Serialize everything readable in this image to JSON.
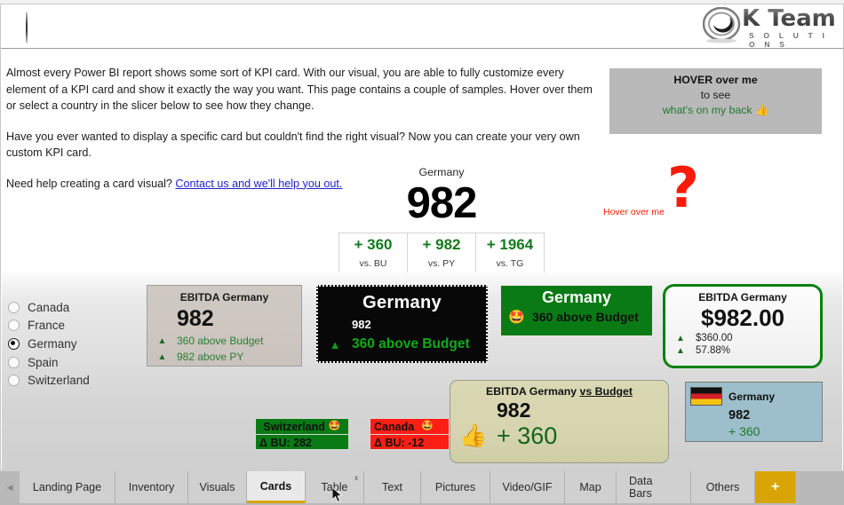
{
  "header": {
    "logo_text": "K Team",
    "logo_sub": "S O L U T I O N S",
    "logo_icon": "swirl-logo-icon"
  },
  "intro": {
    "p1": "Almost every Power BI report shows some sort of KPI card. With our visual, you are able to fully customize every element of a KPI card and show it exactly the way you want. This page contains a couple of samples. Hover over them or select a country in the slicer below to see how they change.",
    "p2": "Have you ever wanted to display a specific card but couldn't find the right visual? Now you can create your very own custom KPI card.",
    "p3_prefix": "Need help creating a card visual? ",
    "p3_link": "Contact us and we'll help you out."
  },
  "hoverbox": {
    "line1": "HOVER over me",
    "line2": "to see",
    "line3": "what's on my back",
    "emoji": "👍",
    "bg": "#b9b9b9",
    "line3_color": "#1f7a2e"
  },
  "hover_question": {
    "label": "Hover over me",
    "mark": "?",
    "color": "#fb1a08"
  },
  "kpi_center": {
    "caption": "Germany",
    "value": "982",
    "cells": [
      {
        "value": "+ 360",
        "label": "vs. BU"
      },
      {
        "value": "+ 982",
        "label": "vs. PY"
      },
      {
        "value": "+ 1964",
        "label": "vs. TG"
      }
    ],
    "value_color": "#167a1e"
  },
  "slicer": {
    "items": [
      {
        "label": "Canada",
        "selected": false
      },
      {
        "label": "France",
        "selected": false
      },
      {
        "label": "Germany",
        "selected": true
      },
      {
        "label": "Spain",
        "selected": false
      },
      {
        "label": "Switzerland",
        "selected": false
      }
    ]
  },
  "cards": {
    "gray": {
      "title": "EBITDA Germany",
      "value": "982",
      "row1_icon": "▲",
      "row1": "360 above Budget",
      "row2_icon": "▲",
      "row2": "982 above PY",
      "bg": "#cdc6c1",
      "accent": "#2e7d32"
    },
    "black": {
      "title": "Germany",
      "value": "982",
      "row_icon": "▲",
      "row": "360 above Budget",
      "bg": "#080808",
      "accent": "#11aa1a"
    },
    "green": {
      "title": "Germany",
      "emoji": "🤩",
      "row": "360 above Budget",
      "bg": "#0a7a14"
    },
    "rounded": {
      "title": "EBITDA Germany",
      "value": "$982.00",
      "row1_icon": "▲",
      "row1": "$360.00",
      "row2_icon": "▲",
      "row2": "57.88%",
      "border": "#0a8012"
    },
    "beige": {
      "title_plain": "EBITDA Germany ",
      "title_underline": "vs Budget",
      "value": "982",
      "emoji": "👍",
      "delta": "+ 360",
      "bg": "#d6d5af",
      "delta_color": "#14651c"
    },
    "blue": {
      "flag": "germany-flag-icon",
      "title": "Germany",
      "value": "982",
      "delta": "+ 360",
      "bg": "#9dbecb",
      "delta_color": "#1a7a28"
    },
    "switzerland": {
      "title": "Switzerland",
      "emoji": "🤩",
      "delta": "Δ BU: 282",
      "bg": "#0a7a14"
    },
    "canada": {
      "title": "Canada",
      "emoji": "🤩",
      "delta": "Δ BU: -12",
      "bg": "#fb1e14"
    }
  },
  "tabs": {
    "items": [
      {
        "label": "Landing Page",
        "active": false
      },
      {
        "label": "Inventory",
        "active": false
      },
      {
        "label": "Visuals",
        "active": false
      },
      {
        "label": "Cards",
        "active": true
      },
      {
        "label": "Table",
        "active": false
      },
      {
        "label": "Text",
        "active": false
      },
      {
        "label": "Pictures",
        "active": false
      },
      {
        "label": "Video/GIF",
        "active": false
      },
      {
        "label": "Map",
        "active": false
      },
      {
        "label": "Data Bars",
        "active": false
      },
      {
        "label": "Others",
        "active": false
      }
    ],
    "add_label": "+",
    "close_label": "x",
    "scroll_left": "◀",
    "active_color": "#d9a406"
  }
}
